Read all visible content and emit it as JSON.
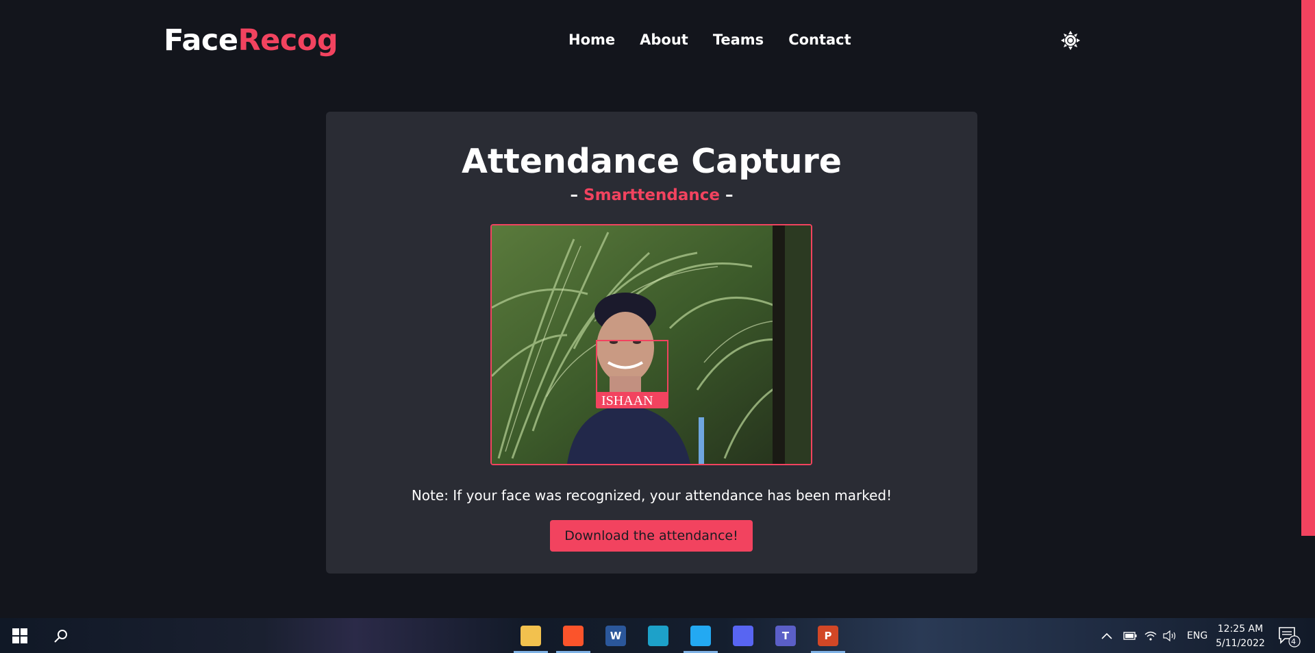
{
  "header": {
    "logo_part1": "Face",
    "logo_part2": "Recog",
    "nav": [
      "Home",
      "About",
      "Teams",
      "Contact"
    ],
    "theme_toggle_icon": "sun-icon"
  },
  "card": {
    "title": "Attendance Capture",
    "subtitle_dash_left": "–",
    "subtitle_name": "Smarttendance",
    "subtitle_dash_right": "–",
    "feed": {
      "detected_name": "ISHAAN"
    },
    "note": "Note: If your face was recognized, your attendance has been marked!",
    "download_label": "Download the attendance!"
  },
  "colors": {
    "accent": "#f2435f",
    "background": "#13151c",
    "card": "#2a2c34"
  },
  "taskbar": {
    "apps": [
      {
        "name": "file-explorer-icon",
        "glyph": "",
        "color": "#f2c14e"
      },
      {
        "name": "brave-icon",
        "glyph": "",
        "color": "#fb542b"
      },
      {
        "name": "word-icon",
        "glyph": "W",
        "color": "#2b579a"
      },
      {
        "name": "edge-icon",
        "glyph": "",
        "color": "#1da1c9"
      },
      {
        "name": "vscode-icon",
        "glyph": "",
        "color": "#23a9f2"
      },
      {
        "name": "discord-icon",
        "glyph": "",
        "color": "#5865f2"
      },
      {
        "name": "teams-icon",
        "glyph": "T",
        "color": "#5b5fc7"
      },
      {
        "name": "powerpoint-icon",
        "glyph": "P",
        "color": "#d24726"
      }
    ],
    "language": "ENG",
    "time": "12:25 AM",
    "date": "5/11/2022",
    "notification_count": "4"
  }
}
